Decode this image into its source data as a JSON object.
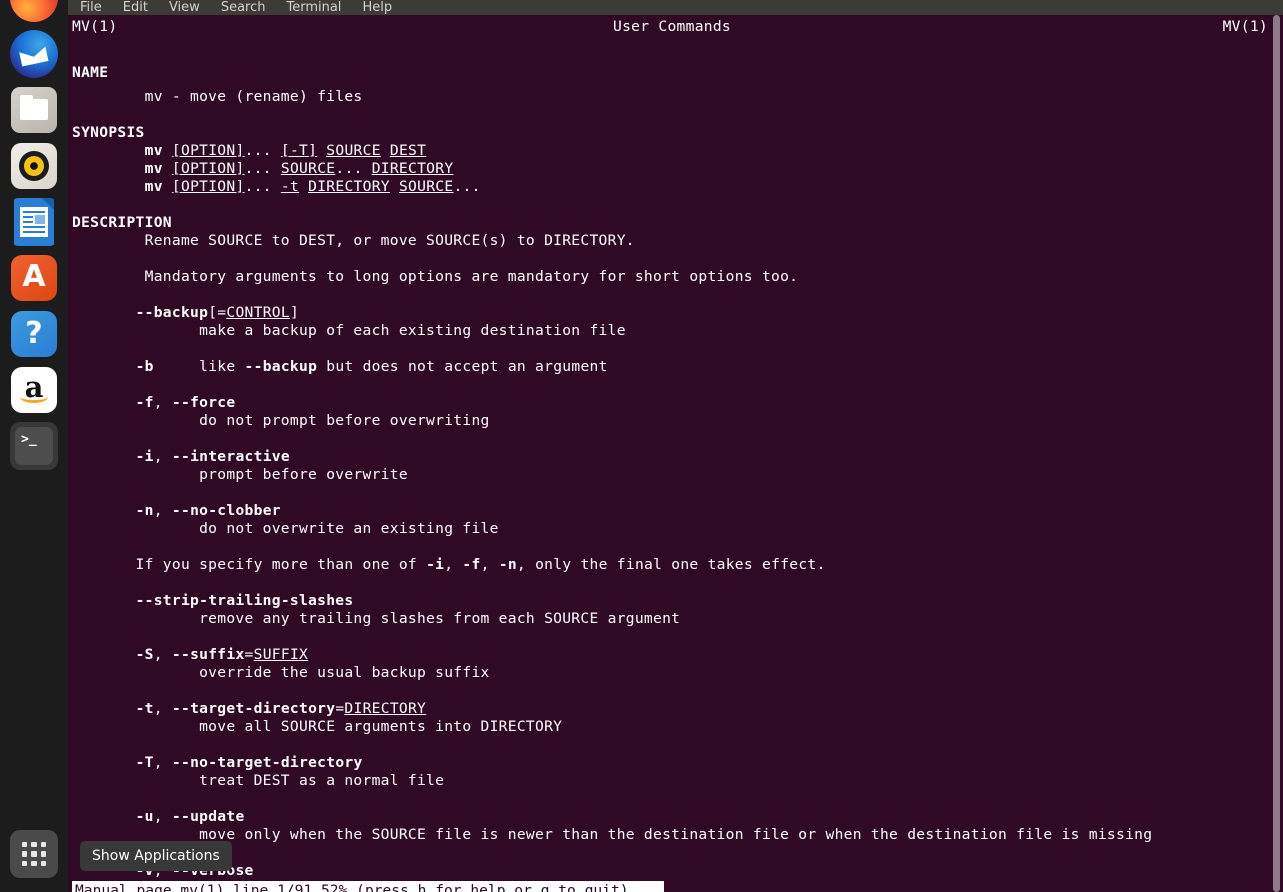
{
  "dock": {
    "items": [
      {
        "name": "firefox",
        "label": "Firefox Web Browser",
        "running": false
      },
      {
        "name": "thunderbird",
        "label": "Thunderbird Mail",
        "running": false
      },
      {
        "name": "files",
        "label": "Files",
        "running": false
      },
      {
        "name": "rhythmbox",
        "label": "Rhythmbox",
        "running": false
      },
      {
        "name": "libreoffice-writer",
        "label": "LibreOffice Writer",
        "running": false
      },
      {
        "name": "ubuntu-software",
        "label": "Ubuntu Software",
        "glyph": "A",
        "running": false
      },
      {
        "name": "help",
        "label": "Help",
        "glyph": "?",
        "running": false
      },
      {
        "name": "amazon",
        "label": "Amazon",
        "glyph": "a",
        "running": false
      },
      {
        "name": "terminal",
        "label": "Terminal",
        "glyph": ">_",
        "running": true
      }
    ],
    "show_applications_label": "Show Applications"
  },
  "tooltip": {
    "text": "Show Applications"
  },
  "terminal": {
    "menu": [
      "File",
      "Edit",
      "View",
      "Search",
      "Terminal",
      "Help"
    ],
    "header": {
      "left": "MV(1)",
      "center": "User Commands",
      "right": "MV(1)"
    },
    "status_line": "Manual page mv(1) line 1/91 52% (press h for help or q to quit)",
    "colors": {
      "background": "#300a24",
      "foreground": "#ffffff",
      "menubar": "#3c3b37",
      "dock": "#1c1c1c",
      "running_dot": "#e9590c",
      "scrollbar_thumb": "#8f7b88"
    },
    "man_page": {
      "command": "mv",
      "section": "1",
      "sections": [
        {
          "heading": "NAME",
          "lines": [
            "        mv - move (rename) files"
          ]
        },
        {
          "heading": "SYNOPSIS",
          "lines": [
            "        mv [OPTION]... [-T] SOURCE DEST",
            "        mv [OPTION]... SOURCE... DIRECTORY",
            "        mv [OPTION]... -t DIRECTORY SOURCE..."
          ]
        },
        {
          "heading": "DESCRIPTION",
          "lines": [
            "        Rename SOURCE to DEST, or move SOURCE(s) to DIRECTORY.",
            "",
            "        Mandatory arguments to long options are mandatory for short options too."
          ]
        }
      ],
      "options": [
        {
          "term": "--backup[=CONTROL]",
          "desc": "make a backup of each existing destination file"
        },
        {
          "term": "-b",
          "desc": "like --backup but does not accept an argument",
          "inline": true
        },
        {
          "term": "-f, --force",
          "desc": "do not prompt before overwriting"
        },
        {
          "term": "-i, --interactive",
          "desc": "prompt before overwrite"
        },
        {
          "term": "-n, --no-clobber",
          "desc": "do not overwrite an existing file"
        },
        {
          "term": "--strip-trailing-slashes",
          "desc": "remove any trailing slashes from each SOURCE argument"
        },
        {
          "term": "-S, --suffix=SUFFIX",
          "desc": "override the usual backup suffix"
        },
        {
          "term": "-t, --target-directory=DIRECTORY",
          "desc": "move all SOURCE arguments into DIRECTORY"
        },
        {
          "term": "-T, --no-target-directory",
          "desc": "treat DEST as a normal file"
        },
        {
          "term": "-u, --update",
          "desc": "move only when the SOURCE file is newer than the destination file or when the destination file is missing"
        },
        {
          "term": "-v, --verbose",
          "desc": ""
        }
      ],
      "note": "If you specify more than one of -i, -f, -n, only the final one takes effect."
    }
  }
}
